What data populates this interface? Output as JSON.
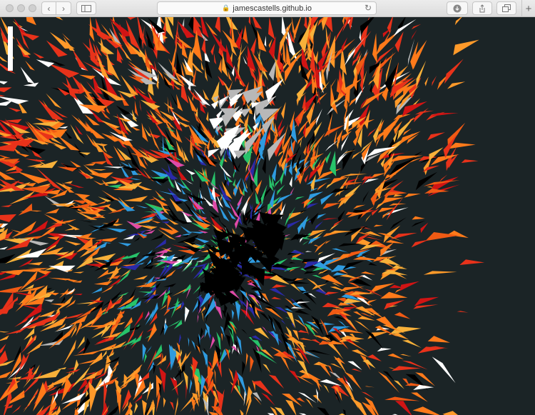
{
  "browser": {
    "url": "jamescastells.github.io",
    "icons": {
      "back": "chevron-left-icon",
      "forward": "chevron-right-icon",
      "sidebar": "sidebar-icon",
      "lock": "lock-icon",
      "reload": "reload-icon",
      "download": "download-icon",
      "share": "share-icon",
      "tabs": "tabs-overview-icon",
      "new_tab": "plus-icon"
    }
  },
  "art": {
    "background": "#1b2426",
    "palette": [
      "#ff7a1a",
      "#f05a14",
      "#e8321a",
      "#ff9a2a",
      "#f7b13a",
      "#d11414",
      "#ffffff",
      "#000000",
      "#2f9be0",
      "#27c36a",
      "#2a2aa8",
      "#e04aa8",
      "#b8b8b8"
    ]
  }
}
